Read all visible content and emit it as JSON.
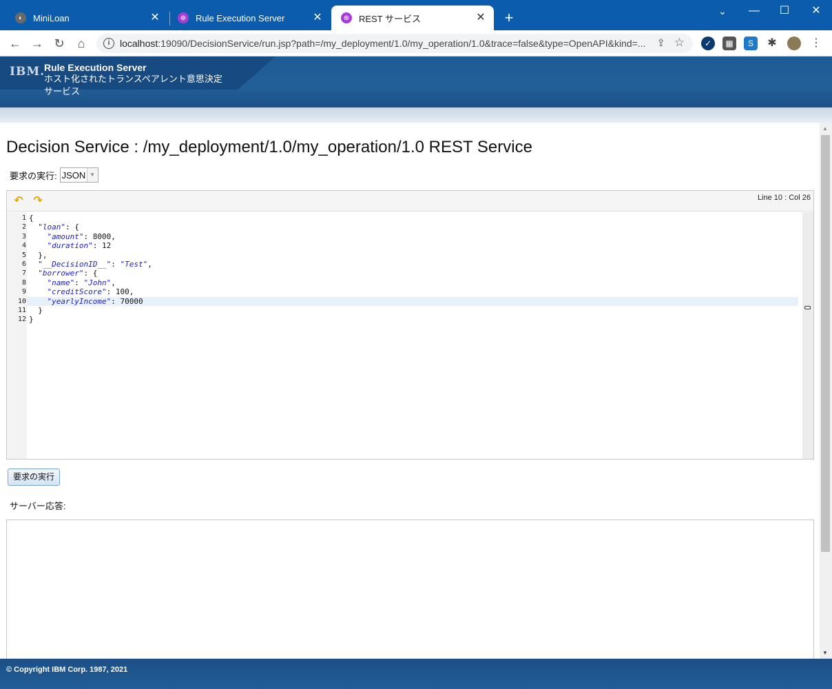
{
  "browser": {
    "tabs": [
      {
        "title": "MiniLoan",
        "icon": "globe-icon"
      },
      {
        "title": "Rule Execution Server",
        "icon": "service-icon"
      },
      {
        "title": "REST サービス",
        "icon": "service-icon"
      }
    ],
    "new_tab": "+",
    "url_host": "localhost",
    "url_rest": ":19090/DecisionService/run.jsp?path=/my_deployment/1.0/my_operation/1.0&trace=false&type=OpenAPI&kind=...",
    "window_controls": {
      "minimize": "—",
      "maximize": "☐",
      "close": "✕",
      "tab_search": "⌄"
    }
  },
  "header": {
    "logo": "IBM.",
    "product": "Rule Execution Server",
    "subtitle": "ホスト化されたトランスペアレント意思決定サービス"
  },
  "page": {
    "title": "Decision Service : /my_deployment/1.0/my_operation/1.0 REST Service",
    "run_label": "要求の実行:",
    "format_value": "JSON",
    "cursor_status": "Line 10 : Col 26",
    "run_button": "要求の実行",
    "response_label": "サーバー応答:"
  },
  "editor": {
    "current_line": 10,
    "lines": [
      [
        {
          "t": "{"
        }
      ],
      [
        {
          "t": "  "
        },
        {
          "k": "\"loan\""
        },
        {
          "t": ": {"
        }
      ],
      [
        {
          "t": "    "
        },
        {
          "k": "\"amount\""
        },
        {
          "t": ": 8000,"
        }
      ],
      [
        {
          "t": "    "
        },
        {
          "k": "\"duration\""
        },
        {
          "t": ": 12"
        }
      ],
      [
        {
          "t": "  },"
        }
      ],
      [
        {
          "t": "  "
        },
        {
          "k": "\"__DecisionID__\""
        },
        {
          "t": ": "
        },
        {
          "k": "\"Test\""
        },
        {
          "t": ","
        }
      ],
      [
        {
          "t": "  "
        },
        {
          "k": "\"borrower\""
        },
        {
          "t": ": {"
        }
      ],
      [
        {
          "t": "    "
        },
        {
          "k": "\"name\""
        },
        {
          "t": ": "
        },
        {
          "k": "\"John\""
        },
        {
          "t": ","
        }
      ],
      [
        {
          "t": "    "
        },
        {
          "k": "\"creditScore\""
        },
        {
          "t": ": 100,"
        }
      ],
      [
        {
          "t": "    "
        },
        {
          "k": "\"yearlyIncome\""
        },
        {
          "t": ": 70000"
        }
      ],
      [
        {
          "t": "  }"
        }
      ],
      [
        {
          "t": "}"
        }
      ]
    ]
  },
  "footer": {
    "copyright": "© Copyright IBM Corp. 1987, 2021"
  },
  "colors": {
    "chrome_blue": "#0b5cad",
    "header_blue": "#235f99",
    "json_key": "#1c1ccc"
  }
}
